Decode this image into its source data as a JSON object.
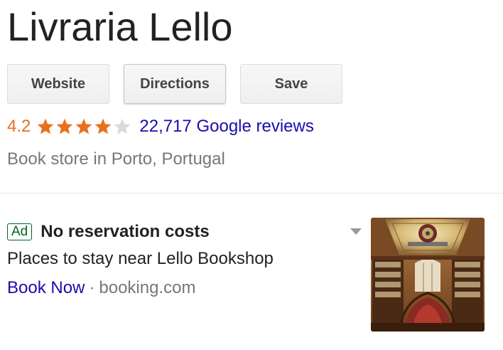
{
  "place": {
    "title": "Livraria Lello",
    "category": "Book store in Porto, Portugal"
  },
  "actions": {
    "website_label": "Website",
    "directions_label": "Directions",
    "save_label": "Save"
  },
  "rating": {
    "value": "4.2",
    "stars_out_of_5": 4.2,
    "reviews_label": "22,717 Google reviews",
    "star_color": "#e7711b",
    "empty_star_color": "#dadada"
  },
  "ad": {
    "badge": "Ad",
    "headline": "No reservation costs",
    "description": "Places to stay near Lello Bookshop",
    "link_label": "Book Now",
    "separator": "·",
    "domain": "booking.com",
    "image_icon": "bookstore-interior-photo"
  },
  "colors": {
    "link": "#1a0dab",
    "ad_green": "#006621",
    "muted": "#777777"
  }
}
